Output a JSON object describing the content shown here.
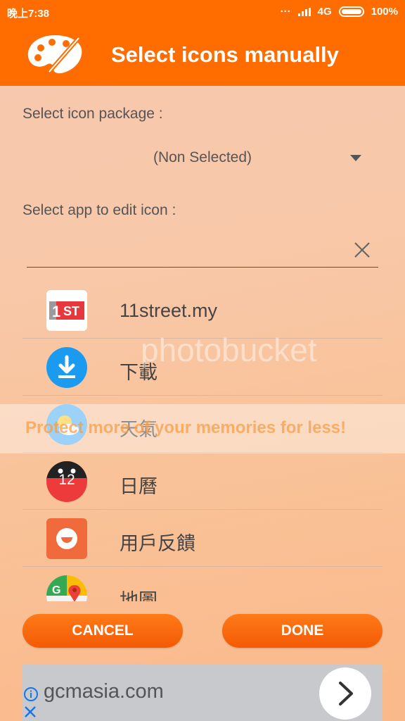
{
  "status_bar": {
    "time": "晚上7:38",
    "network": "4G",
    "battery": "100%"
  },
  "header": {
    "title": "Select icons manually",
    "logo_icon": "palette-icon"
  },
  "icon_package": {
    "label": "Select icon package :",
    "selected": "(Non Selected)"
  },
  "app_select": {
    "label": "Select app to edit icon :",
    "search_value": ""
  },
  "apps": [
    {
      "name": "11street.my",
      "icon": "11street-icon"
    },
    {
      "name": "下載",
      "icon": "download-icon"
    },
    {
      "name": "天氣",
      "icon": "weather-icon"
    },
    {
      "name": "日曆",
      "icon": "calendar-icon",
      "badge": "12"
    },
    {
      "name": "用戶反饋",
      "icon": "feedback-icon"
    },
    {
      "name": "地圖",
      "icon": "maps-icon"
    }
  ],
  "buttons": {
    "cancel": "CANCEL",
    "done": "DONE"
  },
  "ad": {
    "url": "gcmasia.com"
  },
  "watermark": {
    "brand": "photobucket",
    "slogan": "Protect more of your memories for less!"
  },
  "colors": {
    "accent": "#ff6d00",
    "button": "#f96410"
  }
}
